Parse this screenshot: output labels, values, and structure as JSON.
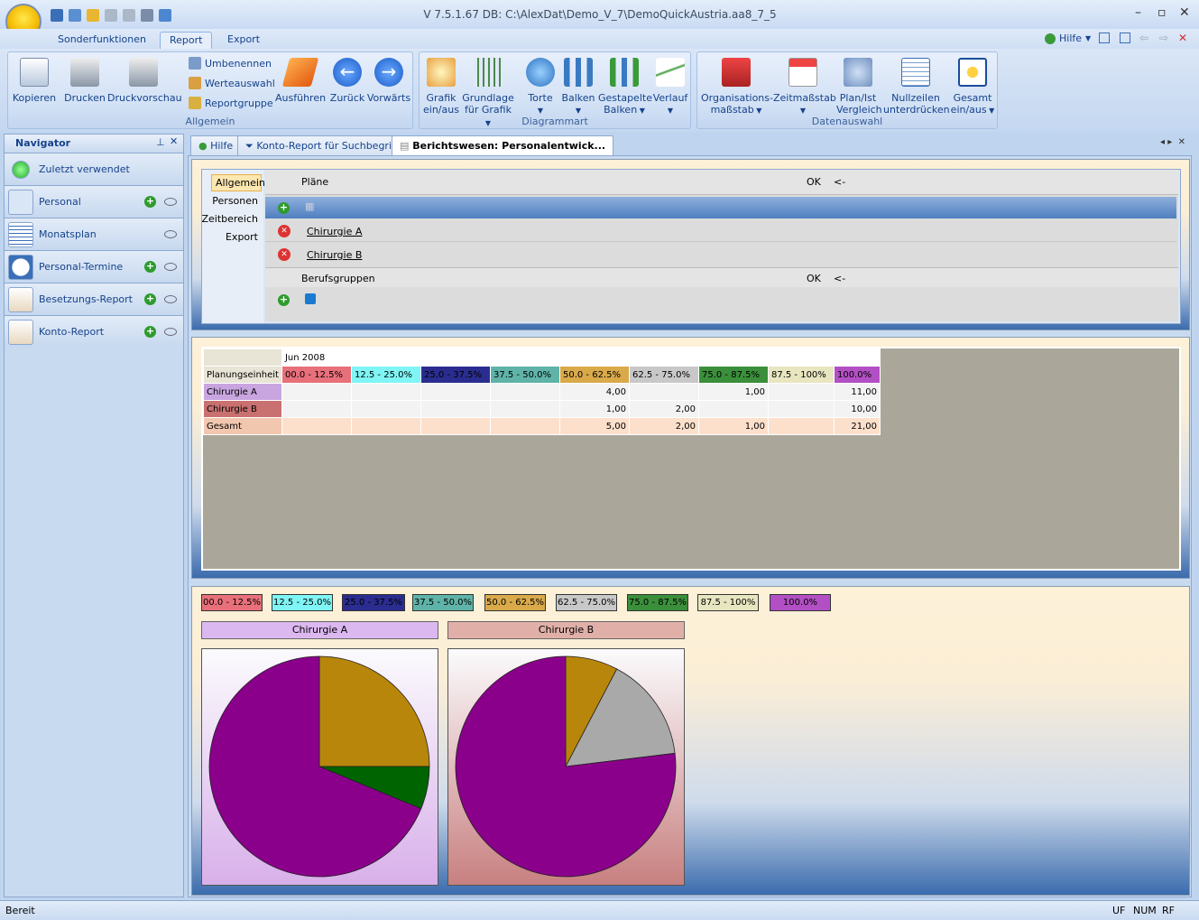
{
  "window": {
    "title": "V 7.5.1.67 DB: C:\\AlexDat\\Demo_V_7\\DemoQuickAustria.aa8_7_5"
  },
  "ribbon_tabs": [
    "Sonderfunktionen",
    "Report",
    "Export"
  ],
  "help_label": "Hilfe",
  "ribbon": {
    "allgemein": {
      "label": "Allgemein",
      "kopieren": "Kopieren",
      "drucken": "Drucken",
      "druckvorschau": "Druckvorschau",
      "umbenennen": "Umbenennen",
      "werteauswahl": "Werteauswahl",
      "reportgruppe": "Reportgruppe",
      "ausfuehren": "Ausführen",
      "zurueck": "Zurück",
      "vorwaerts": "Vorwärts"
    },
    "diagrammart": {
      "label": "Diagrammart",
      "grafik1": "Grafik",
      "grafik2": "ein/aus",
      "grundlage1": "Grundlage",
      "grundlage2": "für Grafik",
      "torte": "Torte",
      "balken": "Balken",
      "gestapelt1": "Gestapelte",
      "gestapelt2": "Balken",
      "verlauf": "Verlauf"
    },
    "datenauswahl": {
      "label": "Datenauswahl",
      "org1": "Organisations-",
      "org2": "maßstab",
      "zeit": "Zeitmaßstab",
      "plan1": "Plan/Ist",
      "plan2": "Vergleich",
      "null1": "Nullzeilen",
      "null2": "unterdrücken",
      "gesamt1": "Gesamt",
      "gesamt2": "ein/aus"
    }
  },
  "navigator": {
    "title": "Navigator",
    "items": [
      "Zuletzt verwendet",
      "Personal",
      "Monatsplan",
      "Personal-Termine",
      "Besetzungs-Report",
      "Konto-Report"
    ]
  },
  "doc_tabs": [
    "Hilfe",
    "Konto-Report für Suchbegriff",
    "Berichtswesen: Personalentwick..."
  ],
  "filter": {
    "side_tabs": [
      "Allgemein",
      "Personen",
      "Zeitbereich",
      "Export"
    ],
    "plaene_header": "Pläne",
    "ok": "OK",
    "arrow": "<-",
    "plans": [
      "Chirurgie A",
      "Chirurgie B"
    ],
    "berufsgruppen": "Berufsgruppen"
  },
  "report": {
    "month": "Jun 2008",
    "row_header": "Planungseinheit",
    "ranges": [
      "00.0 - 12.5%",
      "12.5 - 25.0%",
      "25.0 - 37.5%",
      "37.5 - 50.0%",
      "50.0 - 62.5%",
      "62.5 - 75.0%",
      "75.0 - 87.5%",
      "87.5 - 100%",
      "100.0%"
    ],
    "rows": [
      {
        "name": "Chirurgie A",
        "values": [
          "",
          "",
          "",
          "",
          "4,00",
          "",
          "1,00",
          "",
          "11,00"
        ]
      },
      {
        "name": "Chirurgie B",
        "values": [
          "",
          "",
          "",
          "",
          "1,00",
          "2,00",
          "",
          "",
          "10,00"
        ]
      },
      {
        "name": "Gesamt",
        "values": [
          "",
          "",
          "",
          "",
          "5,00",
          "2,00",
          "1,00",
          "",
          "21,00"
        ]
      }
    ]
  },
  "legend_colors": [
    "#e8707a",
    "#7ff5f5",
    "#2a2d8f",
    "#5fb3a8",
    "#d9a94a",
    "#c8c8c8",
    "#3b8f3b",
    "#e8e6c0",
    "#b34fc4"
  ],
  "chart_data": [
    {
      "type": "pie",
      "title": "Chirurgie A",
      "categories": [
        "50.0 - 62.5%",
        "75.0 - 87.5%",
        "100.0%"
      ],
      "values": [
        4,
        1,
        11
      ],
      "colors": [
        "#b8860b",
        "#006400",
        "#8b008b"
      ]
    },
    {
      "type": "pie",
      "title": "Chirurgie B",
      "categories": [
        "50.0 - 62.5%",
        "62.5 - 75.0%",
        "100.0%"
      ],
      "values": [
        1,
        2,
        10
      ],
      "colors": [
        "#b8860b",
        "#a9a9a9",
        "#8b008b"
      ]
    }
  ],
  "status": {
    "left": "Bereit",
    "uf": "UF",
    "num": "NUM",
    "rf": "RF"
  }
}
